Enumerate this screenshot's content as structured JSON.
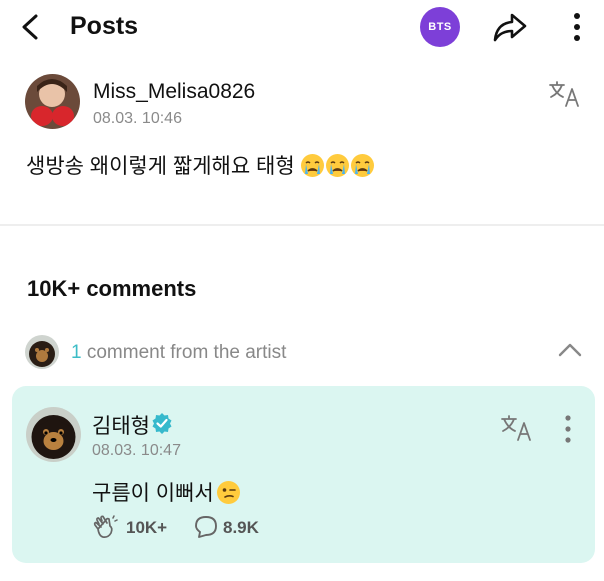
{
  "header": {
    "title": "Posts",
    "community_badge": "BTS",
    "badge_color": "#7d3fd8"
  },
  "post": {
    "author": "Miss_Melisa0826",
    "time": "08.03. 10:46",
    "text": "생방송 왜이렇게 짧게해요 태형",
    "trailing_emoji": [
      "crying-face-icon",
      "crying-face-icon",
      "crying-face-icon"
    ]
  },
  "comments": {
    "heading": "10K+ comments",
    "artist_comment_count": "1",
    "artist_comment_label": " comment from the artist",
    "accent_color": "#3cbcc6",
    "artist_comment": {
      "author": "김태형",
      "verified": true,
      "time": "08.03. 10:47",
      "text": "구름이 이뻐서",
      "trailing_emoji": "winking-face-icon",
      "likes": "10K+",
      "replies": "8.9K",
      "card_color": "#dbf6f1"
    }
  }
}
